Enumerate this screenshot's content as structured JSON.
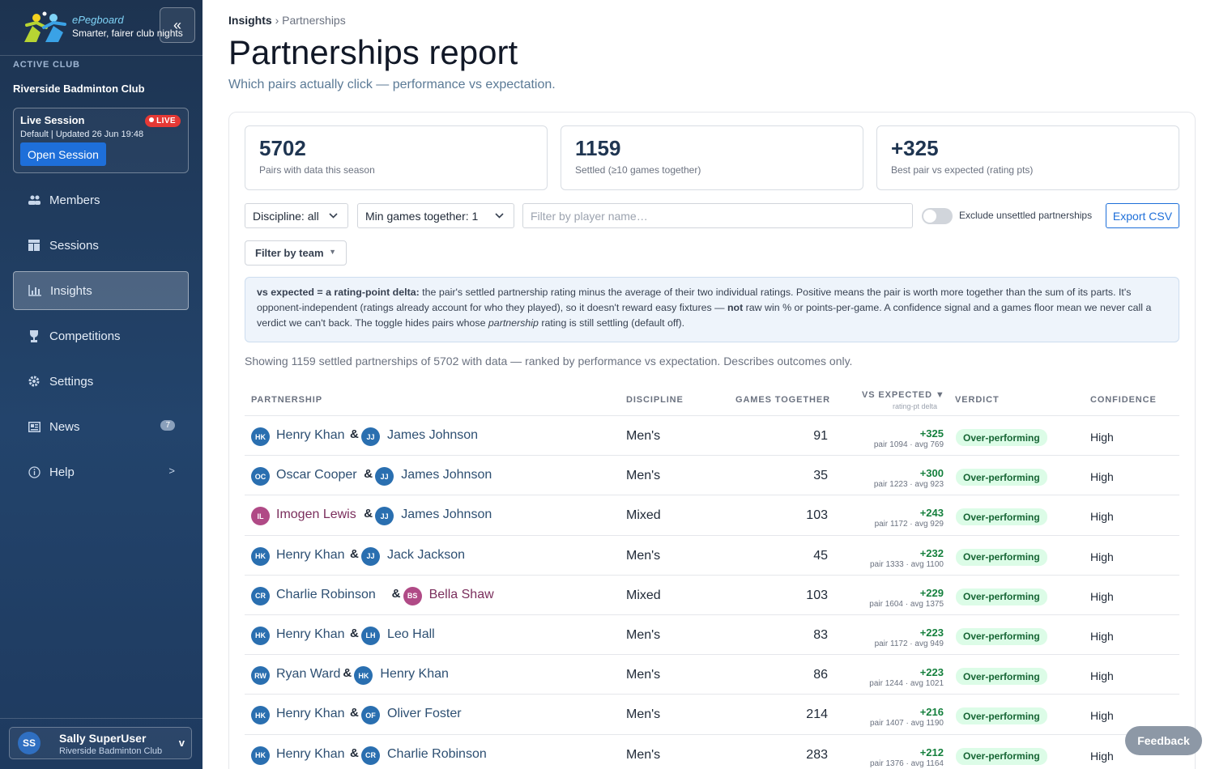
{
  "brand": {
    "name": "ePegboard",
    "tagline": "Smarter, fairer club nights",
    "collapse_glyph": "«"
  },
  "sidebar": {
    "active_club_label": "ACTIVE CLUB",
    "club_name": "Riverside Badminton Club",
    "session": {
      "title": "Live Session",
      "badge": "LIVE",
      "meta": "Default | Updated 26 Jun 19:48",
      "button": "Open Session"
    },
    "items": [
      {
        "label": "Members",
        "icon": "members-icon"
      },
      {
        "label": "Sessions",
        "icon": "sessions-icon"
      },
      {
        "label": "Insights",
        "icon": "insights-icon",
        "active": true
      },
      {
        "label": "Competitions",
        "icon": "trophy-icon"
      },
      {
        "label": "Settings",
        "icon": "gear-icon"
      },
      {
        "label": "News",
        "icon": "news-icon",
        "badge": "7"
      },
      {
        "label": "Help",
        "icon": "help-icon",
        "chevron": ">"
      }
    ],
    "user": {
      "initials": "SS",
      "name": "Sally SuperUser",
      "club": "Riverside Badminton Club",
      "chevron": "v"
    }
  },
  "breadcrumb": {
    "parent": "Insights",
    "separator": "›",
    "current": "Partnerships"
  },
  "page": {
    "title": "Partnerships report",
    "subtitle": "Which pairs actually click — performance vs expectation."
  },
  "stats": [
    {
      "value": "5702",
      "label": "Pairs with data this season"
    },
    {
      "value": "1159",
      "label": "Settled (≥10 games together)"
    },
    {
      "value": "+325",
      "label": "Best pair vs expected (rating pts)"
    }
  ],
  "filters": {
    "discipline": "Discipline: all",
    "min_games": "Min games together: 1",
    "player_placeholder": "Filter by player name…",
    "exclude_label": "Exclude unsettled partnerships",
    "export_label": "Export CSV",
    "team_label": "Filter by team"
  },
  "info": {
    "p1_bold": "vs expected = a rating-point delta:",
    "p1": " the pair's settled partnership rating minus the average of their two individual ratings. Positive means the pair is worth more together than the sum of its parts. It's opponent-independent (ratings already account for who they played), so it doesn't reward easy fixtures — ",
    "p2_bold": "not",
    "p2": " raw win % or points-per-game. A confidence signal and a games floor mean we never call a verdict we can't back. The toggle hides pairs whose ",
    "p3_italic": "partnership",
    "p3": " rating is still settling (default off)."
  },
  "showing": "Showing 1159 settled partnerships of 5702 with data — ranked by performance vs expectation. Describes outcomes only.",
  "columns": {
    "partnership": "PARTNERSHIP",
    "discipline": "DISCIPLINE",
    "games": "GAMES TOGETHER",
    "vs_expected": "VS EXPECTED ▼",
    "vs_expected_sub": "rating-pt delta",
    "verdict": "VERDICT",
    "confidence": "CONFIDENCE"
  },
  "colors": {
    "male_avatar": "#2a6fb0",
    "female_avatar": "#b04a86",
    "male_name": "#2d4f72",
    "female_name": "#7a2e5c"
  },
  "rows": [
    {
      "p1": {
        "initials": "HK",
        "name": "Henry Khan",
        "gender": "m"
      },
      "p2": {
        "initials": "JJ",
        "name": "James Johnson",
        "gender": "m"
      },
      "discipline": "Men's",
      "games": "91",
      "delta": "+325",
      "pair_avg": "pair 1094 · avg 769",
      "verdict": "Over-performing",
      "confidence": "High"
    },
    {
      "p1": {
        "initials": "OC",
        "name": "Oscar Cooper",
        "gender": "m"
      },
      "p2": {
        "initials": "JJ",
        "name": "James Johnson",
        "gender": "m"
      },
      "discipline": "Men's",
      "games": "35",
      "delta": "+300",
      "pair_avg": "pair 1223 · avg 923",
      "verdict": "Over-performing",
      "confidence": "High"
    },
    {
      "p1": {
        "initials": "IL",
        "name": "Imogen Lewis",
        "gender": "f"
      },
      "p2": {
        "initials": "JJ",
        "name": "James Johnson",
        "gender": "m"
      },
      "discipline": "Mixed",
      "games": "103",
      "delta": "+243",
      "pair_avg": "pair 1172 · avg 929",
      "verdict": "Over-performing",
      "confidence": "High"
    },
    {
      "p1": {
        "initials": "HK",
        "name": "Henry Khan",
        "gender": "m"
      },
      "p2": {
        "initials": "JJ",
        "name": "Jack Jackson",
        "gender": "m"
      },
      "discipline": "Men's",
      "games": "45",
      "delta": "+232",
      "pair_avg": "pair 1333 · avg 1100",
      "verdict": "Over-performing",
      "confidence": "High"
    },
    {
      "p1": {
        "initials": "CR",
        "name": "Charlie Robinson",
        "gender": "m"
      },
      "p2": {
        "initials": "BS",
        "name": "Bella Shaw",
        "gender": "f"
      },
      "discipline": "Mixed",
      "games": "103",
      "delta": "+229",
      "pair_avg": "pair 1604 · avg 1375",
      "verdict": "Over-performing",
      "confidence": "High"
    },
    {
      "p1": {
        "initials": "HK",
        "name": "Henry Khan",
        "gender": "m"
      },
      "p2": {
        "initials": "LH",
        "name": "Leo Hall",
        "gender": "m"
      },
      "discipline": "Men's",
      "games": "83",
      "delta": "+223",
      "pair_avg": "pair 1172 · avg 949",
      "verdict": "Over-performing",
      "confidence": "High"
    },
    {
      "p1": {
        "initials": "RW",
        "name": "Ryan Ward",
        "gender": "m"
      },
      "p2": {
        "initials": "HK",
        "name": "Henry Khan",
        "gender": "m"
      },
      "discipline": "Men's",
      "games": "86",
      "delta": "+223",
      "pair_avg": "pair 1244 · avg 1021",
      "verdict": "Over-performing",
      "confidence": "High"
    },
    {
      "p1": {
        "initials": "HK",
        "name": "Henry Khan",
        "gender": "m"
      },
      "p2": {
        "initials": "OF",
        "name": "Oliver Foster",
        "gender": "m"
      },
      "discipline": "Men's",
      "games": "214",
      "delta": "+216",
      "pair_avg": "pair 1407 · avg 1190",
      "verdict": "Over-performing",
      "confidence": "High"
    },
    {
      "p1": {
        "initials": "HK",
        "name": "Henry Khan",
        "gender": "m"
      },
      "p2": {
        "initials": "CR",
        "name": "Charlie Robinson",
        "gender": "m"
      },
      "discipline": "Men's",
      "games": "283",
      "delta": "+212",
      "pair_avg": "pair 1376 · avg 1164",
      "verdict": "Over-performing",
      "confidence": "High"
    }
  ],
  "feedback": "Feedback"
}
